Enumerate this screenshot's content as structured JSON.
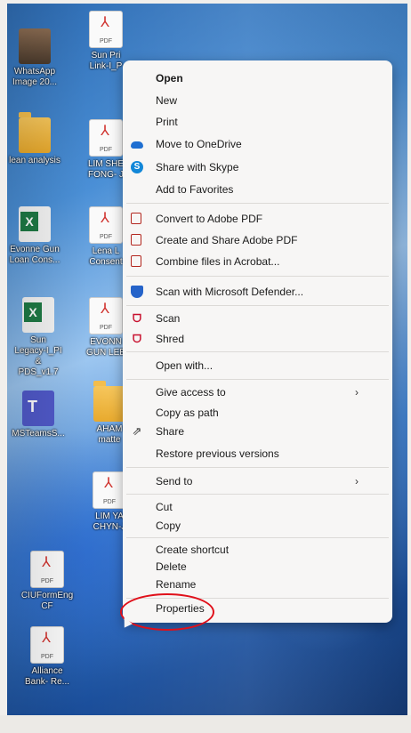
{
  "desktop_icons": [
    {
      "label": "WhatsApp\nImage 20...",
      "icon": "image-file-icon",
      "kind": "photo"
    },
    {
      "label": "Sun Pri\nLink-I_P",
      "icon": "pdf-file-icon",
      "kind": "pdf"
    },
    {
      "label": "lean analysis",
      "icon": "folder-icon",
      "kind": "folder"
    },
    {
      "label": "LIM SHE\nFONG- J",
      "icon": "pdf-file-icon",
      "kind": "pdf"
    },
    {
      "label": "Evonne Gun\nLoan Cons...",
      "icon": "excel-file-icon",
      "kind": "excel"
    },
    {
      "label": "Lena L\nConsent",
      "icon": "pdf-file-icon",
      "kind": "pdf"
    },
    {
      "label": "Sun\nLegacy-I_PI &\nPDS_v1.7",
      "icon": "excel-file-icon",
      "kind": "excel"
    },
    {
      "label": "EVONN\nGUN LEE",
      "icon": "pdf-file-icon",
      "kind": "pdf"
    },
    {
      "label": "MSTeamsS...",
      "icon": "teams-icon",
      "kind": "teams"
    },
    {
      "label": "AHAM\nmatte",
      "icon": "folder-icon",
      "kind": "folder"
    },
    {
      "label": "LIM YA\nCHYN-J",
      "icon": "pdf-file-icon",
      "kind": "pdf"
    },
    {
      "label": "CIUFormEng\nCF",
      "icon": "pdf-file-icon",
      "kind": "pdf"
    },
    {
      "label": "Alliance\nBank- Re...",
      "icon": "pdf-file-icon",
      "kind": "pdf"
    }
  ],
  "pdf_badge": "PDF",
  "context_menu": {
    "items": [
      {
        "label": "Open",
        "bold": true,
        "icon": ""
      },
      {
        "label": "New",
        "icon": ""
      },
      {
        "label": "Print",
        "icon": ""
      },
      {
        "label": "Move to OneDrive",
        "icon": "onedrive-cloud-icon"
      },
      {
        "label": "Share with Skype",
        "icon": "skype-icon"
      },
      {
        "label": "Add to Favorites",
        "icon": ""
      },
      {
        "label": "Convert to Adobe PDF",
        "icon": "acrobat-convert-icon"
      },
      {
        "label": "Create and Share Adobe PDF",
        "icon": "acrobat-share-icon"
      },
      {
        "label": "Combine files in Acrobat...",
        "icon": "acrobat-combine-icon"
      },
      {
        "label": "Scan with Microsoft Defender...",
        "icon": "defender-shield-icon"
      },
      {
        "label": "Scan",
        "icon": "mcafee-icon"
      },
      {
        "label": "Shred",
        "icon": "mcafee-icon"
      },
      {
        "label": "Open with...",
        "icon": ""
      },
      {
        "label": "Give access to",
        "icon": "",
        "submenu": true
      },
      {
        "label": "Copy as path",
        "icon": ""
      },
      {
        "label": "Share",
        "icon": "share-icon"
      },
      {
        "label": "Restore previous versions",
        "icon": ""
      },
      {
        "label": "Send to",
        "icon": "",
        "submenu": true
      },
      {
        "label": "Cut",
        "icon": ""
      },
      {
        "label": "Copy",
        "icon": ""
      },
      {
        "label": "Create shortcut",
        "icon": ""
      },
      {
        "label": "Delete",
        "icon": ""
      },
      {
        "label": "Rename",
        "icon": ""
      },
      {
        "label": "Properties",
        "icon": ""
      }
    ],
    "submenu_arrow": "›"
  },
  "colors": {
    "annotation_ring": "#e0101a",
    "menu_background": "#f7f6f5"
  }
}
